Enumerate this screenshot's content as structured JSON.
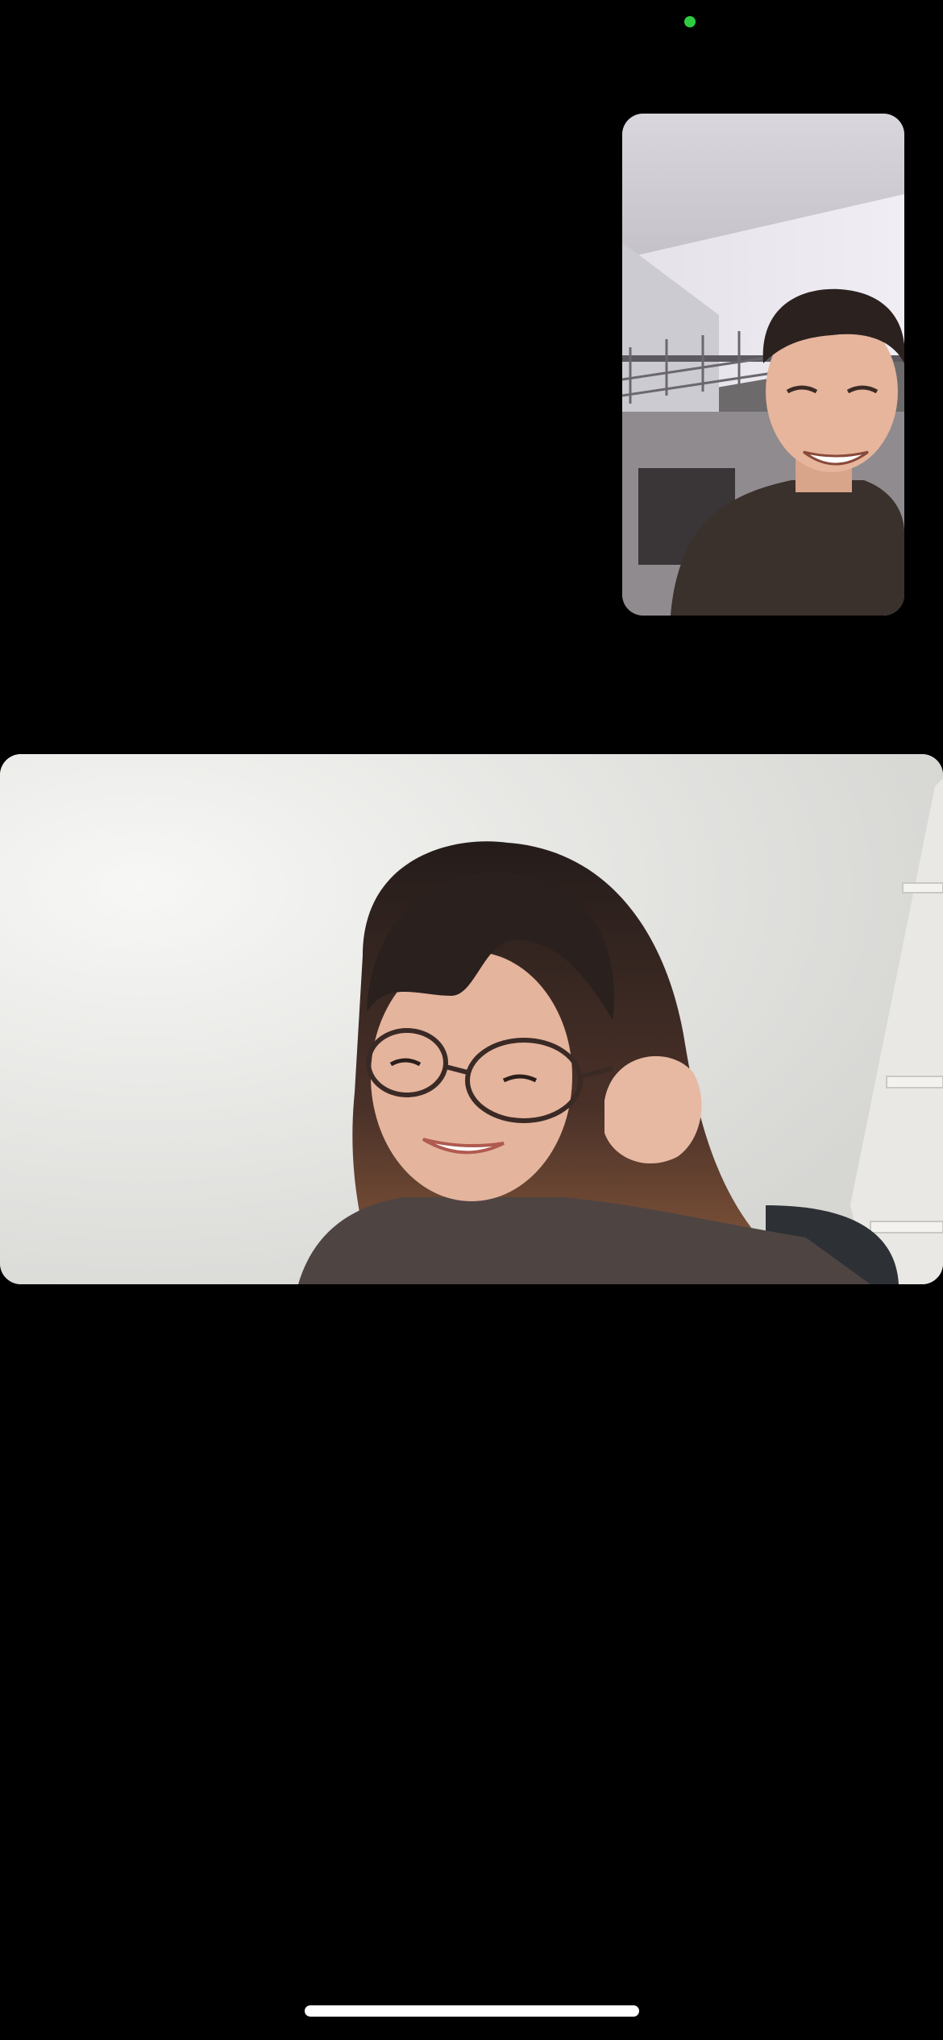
{
  "call": {
    "type": "video-call",
    "self_view": {
      "icon": "person-video-feed",
      "label": ""
    },
    "remote_view": {
      "icon": "person-video-feed",
      "label": ""
    }
  },
  "status": {
    "camera_indicator": "on",
    "camera_indicator_color": "#2ecc40"
  },
  "colors": {
    "background": "#000000",
    "home_indicator": "#ffffff"
  }
}
